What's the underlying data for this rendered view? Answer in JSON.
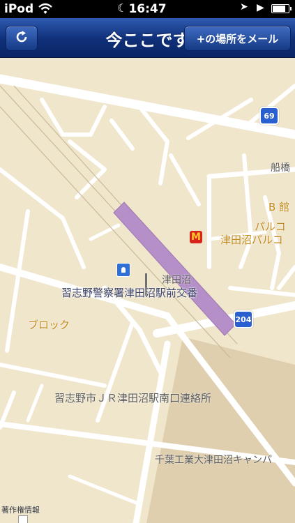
{
  "status_bar": {
    "carrier": "iPod",
    "time": "16:47",
    "icons": [
      "wifi-icon",
      "moon-icon",
      "location-arrow-icon",
      "play-icon",
      "battery-icon"
    ],
    "battery_level": 0.9
  },
  "nav": {
    "title": "今ここです",
    "mail_button": "+の場所をメール",
    "refresh_icon": "refresh-icon",
    "colors": {
      "bar": "#0f2f78",
      "button": "#153a85"
    }
  },
  "map": {
    "labels": {
      "tsudanuma": "津田沼",
      "koban": "習志野警察署津田沼駅前交番",
      "block": "ブロック",
      "minami": "習志野市ＪＲ津田沼駅南口連絡所",
      "chiba": "千葉工業大津田沼キャンパ",
      "funabashi": "船橋",
      "b_kan": "B 館",
      "parco": "パルコ",
      "tsudanuma_parco": "津田沼パルコ",
      "copyright": "著作権情報"
    },
    "route_shields": [
      "69",
      "204"
    ],
    "poi_icons": [
      "mcdonalds-icon",
      "police-box-icon",
      "seven-eleven-icon"
    ],
    "colors": {
      "land": "#f0e6cc",
      "road": "#ffffff",
      "rail": "#b58fc8",
      "campus": "#dfcfae"
    }
  }
}
